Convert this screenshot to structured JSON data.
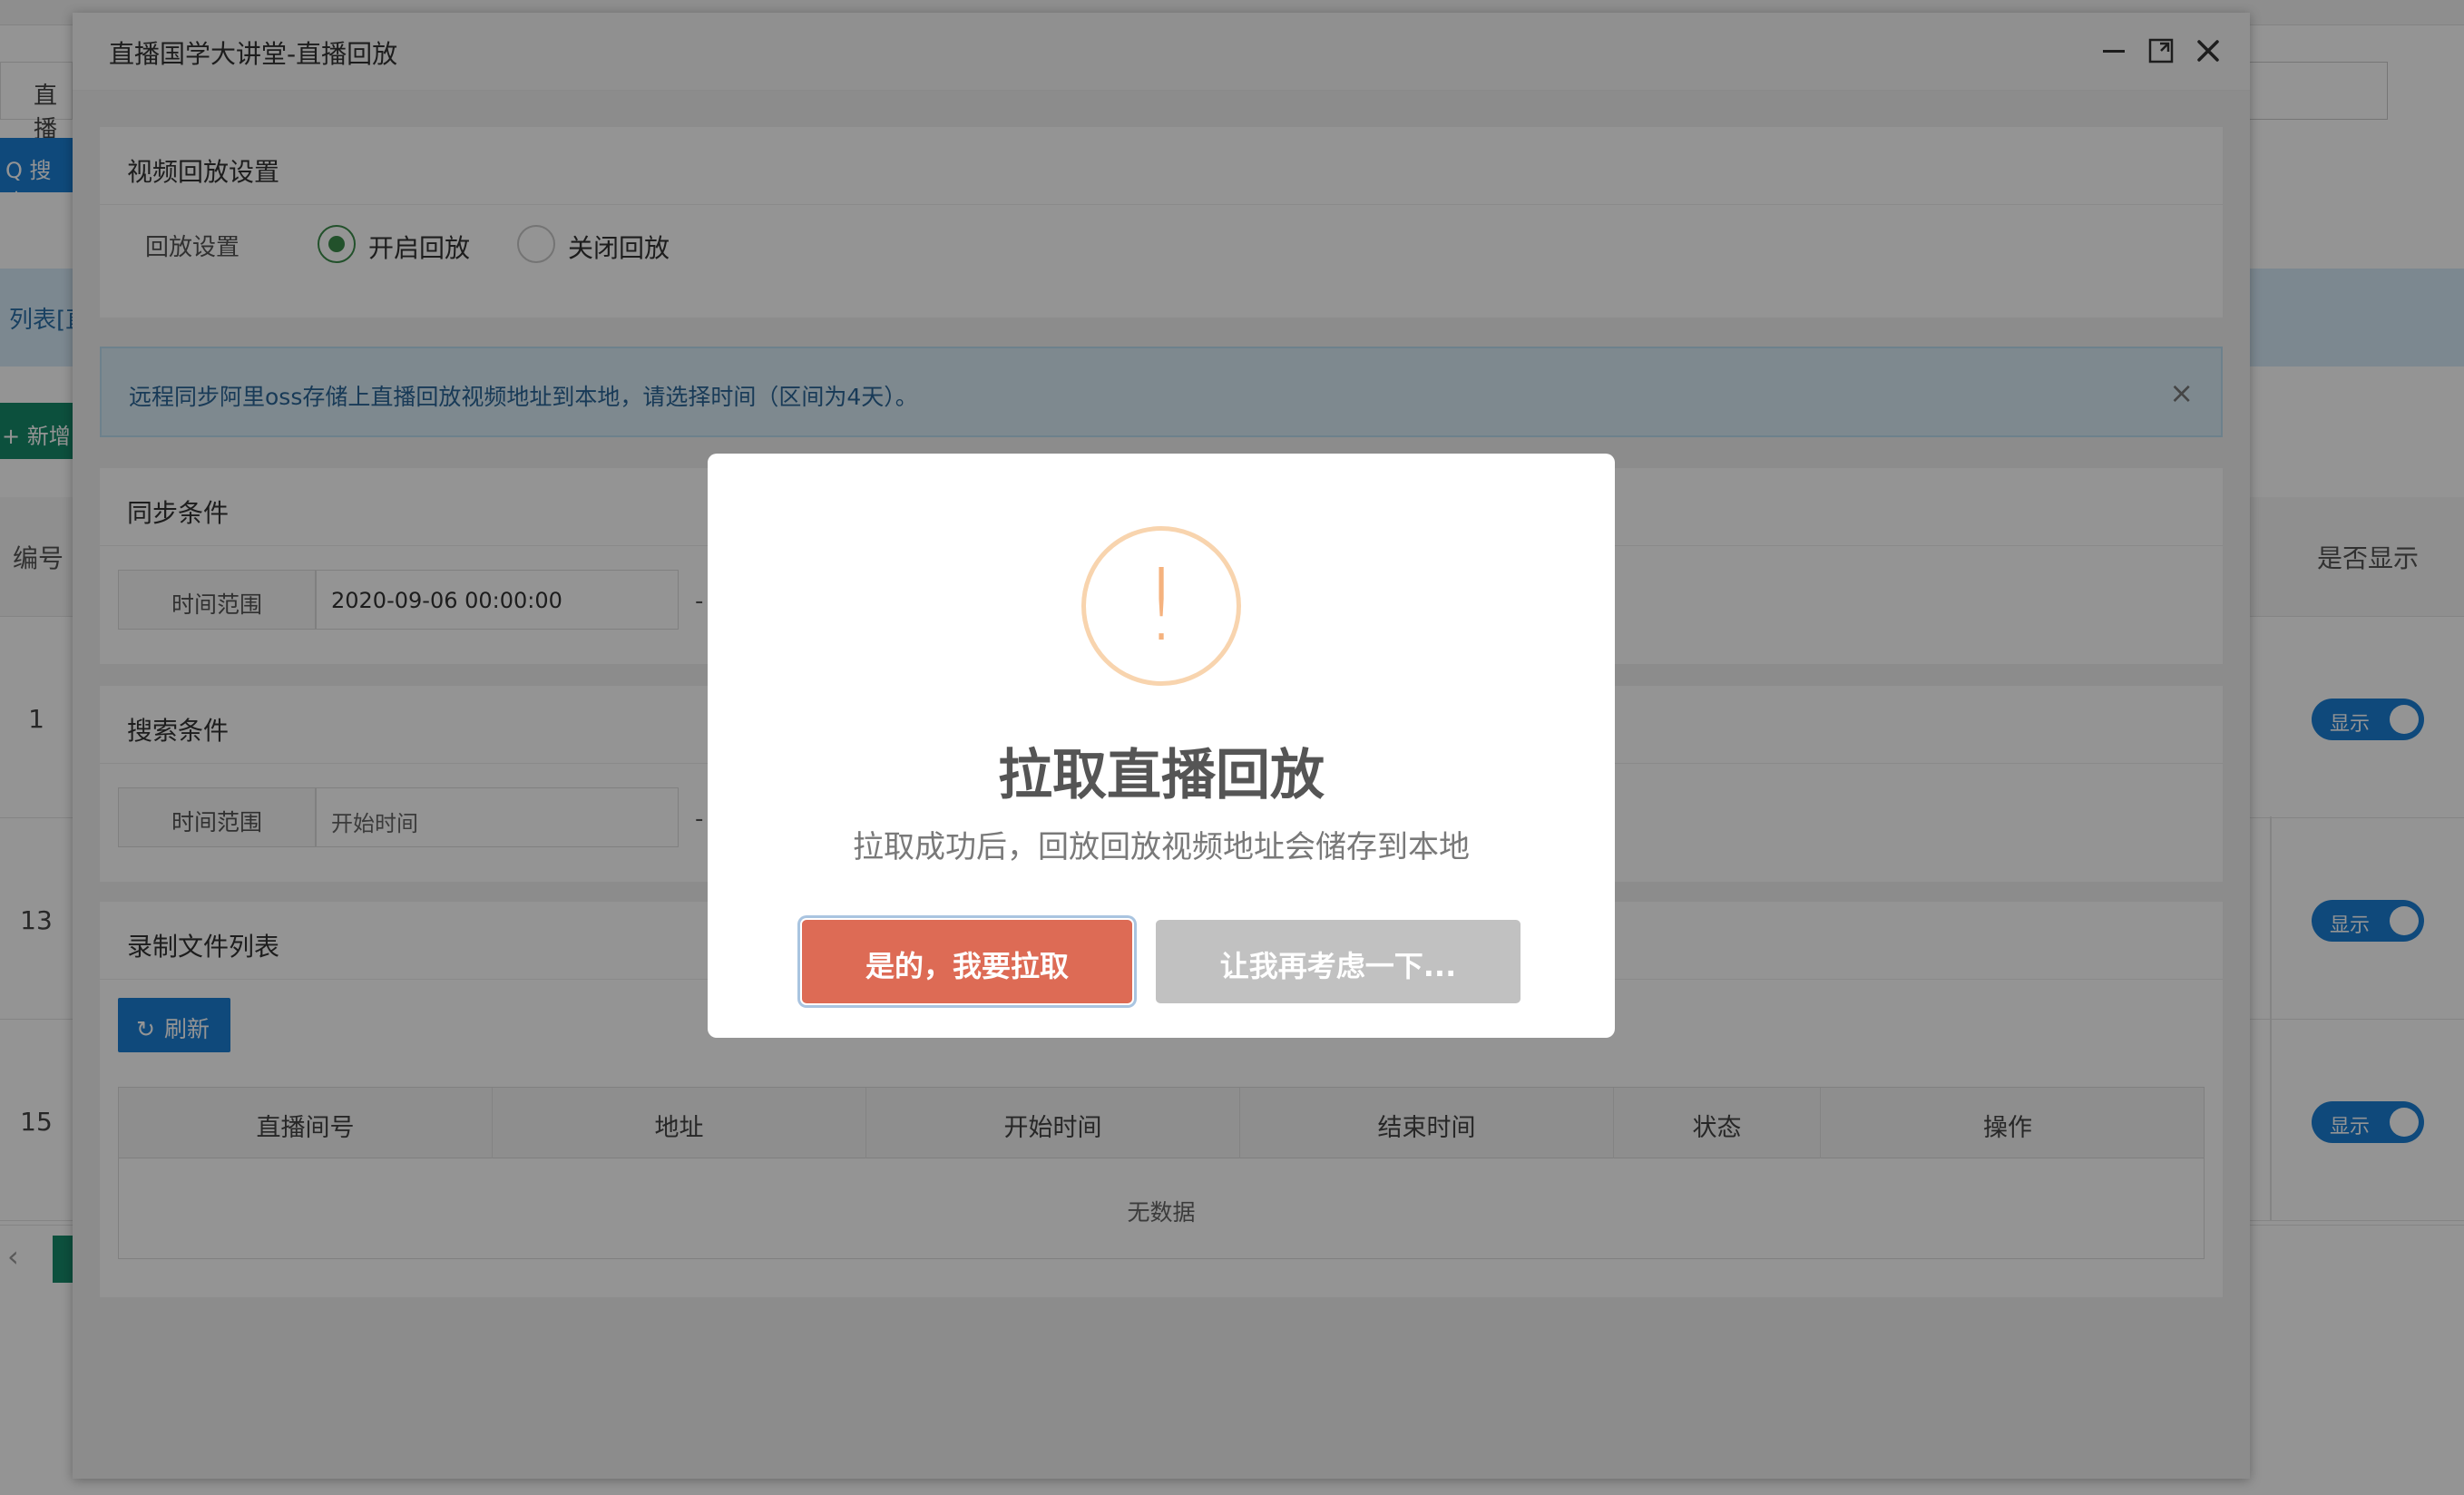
{
  "background": {
    "search_input_prefix": "直播",
    "search_button": "Q 搜索",
    "list_label": "列表[直",
    "add_button": "+ 新增",
    "columns": {
      "id": "编号",
      "show": "是否显示"
    },
    "rows": [
      {
        "id": "1",
        "toggle": "显示"
      },
      {
        "id": "13",
        "toggle": "显示"
      },
      {
        "id": "15",
        "toggle": "显示"
      }
    ],
    "pager_prev": "‹"
  },
  "layer": {
    "title": "直播国学大讲堂-直播回放",
    "replay_panel": {
      "heading": "视频回放设置",
      "field_label": "回放设置",
      "option_on": "开启回放",
      "option_off": "关闭回放",
      "selected": "开启回放"
    },
    "alert": {
      "text": "远程同步阿里oss存储上直播回放视频地址到本地，请选择时间（区间为4天）。",
      "close": "×"
    },
    "sync_panel": {
      "heading": "同步条件",
      "label": "时间范围",
      "value": "2020-09-06 00:00:00",
      "dash": "-"
    },
    "search_panel": {
      "heading": "搜索条件",
      "label": "时间范围",
      "placeholder": "开始时间",
      "dash": "-"
    },
    "files_panel": {
      "heading": "录制文件列表",
      "refresh_button": "刷新",
      "columns": [
        "直播间号",
        "地址",
        "开始时间",
        "结束时间",
        "状态",
        "操作"
      ],
      "empty_text": "无数据"
    }
  },
  "dialog": {
    "icon": "exclamation-icon",
    "icon_glyph": "!",
    "title": "拉取直播回放",
    "text": "拉取成功后，回放回放视频地址会储存到本地",
    "confirm": "是的，我要拉取",
    "cancel": "让我再考虑一下...",
    "colors": {
      "confirm": "#dd6b55",
      "cancel": "#c1c1c1",
      "warning": "#f5b27e"
    }
  }
}
